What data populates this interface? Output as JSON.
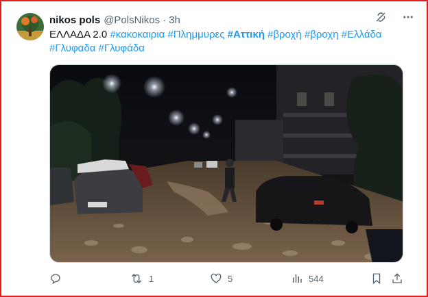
{
  "tweet": {
    "author_name": "nikos pols",
    "author_handle": "@PolsNikos",
    "separator": "·",
    "time_ago": "3h",
    "text_parts": [
      {
        "text": "ΕΛΛΑΔΑ 2.0 ",
        "type": "plain"
      },
      {
        "text": "#κακοκαιρια",
        "type": "tag"
      },
      {
        "text": " ",
        "type": "plain"
      },
      {
        "text": "#Πλημμυρες",
        "type": "tag"
      },
      {
        "text": " ",
        "type": "plain"
      },
      {
        "text": "#Αττική",
        "type": "tag-bold"
      },
      {
        "text": " ",
        "type": "plain"
      },
      {
        "text": "#βροχή",
        "type": "tag"
      },
      {
        "text": " ",
        "type": "plain"
      },
      {
        "text": "#βροχη",
        "type": "tag"
      },
      {
        "text": " ",
        "type": "plain"
      },
      {
        "text": "#Ελλάδα",
        "type": "tag"
      },
      {
        "text": " ",
        "type": "plain"
      },
      {
        "text": "#Γλυφαδα",
        "type": "tag"
      },
      {
        "text": " ",
        "type": "plain"
      },
      {
        "text": "#Γλυφάδα",
        "type": "tag"
      }
    ],
    "media_description_icon": "photo",
    "actions": {
      "reply_count": "",
      "retweet_count": "1",
      "like_count": "5",
      "view_count": "544"
    }
  },
  "icons": {
    "grok": "grok-icon",
    "more": "more-icon",
    "reply": "reply-icon",
    "retweet": "retweet-icon",
    "like": "heart-icon",
    "views": "views-icon",
    "bookmark": "bookmark-icon",
    "share": "share-icon"
  },
  "colors": {
    "link": "#1d9bf0",
    "muted": "#536471",
    "text": "#0f1419",
    "frame": "#e0201f"
  }
}
